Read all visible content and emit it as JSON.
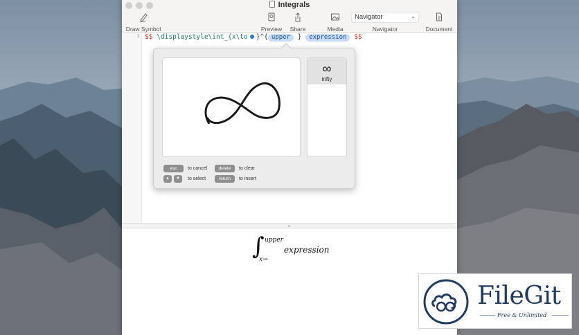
{
  "window": {
    "title": "Integrals"
  },
  "toolbar": {
    "draw_symbol_label": "Draw Symbol",
    "preview_label": "Preview",
    "share_label": "Share",
    "media_label": "Media",
    "navigator_label": "Navigator",
    "navigator_selected": "Navigator",
    "document_label": "Document"
  },
  "editor": {
    "line_number": "1",
    "code_prefix_dollar": "$$",
    "code_command": "\\displaystyle\\int_{x\\to",
    "code_after_dot": "}^{",
    "token_upper": "upper",
    "code_close_brace": "}",
    "token_expression": "expression",
    "code_suffix_dollar": "$$"
  },
  "draw_popover": {
    "result": {
      "glyph": "∞",
      "label": "infty"
    },
    "hints": {
      "esc_key": "esc",
      "cancel_text": "to cancel",
      "delete_key": "delete",
      "clear_text": "to clear",
      "up_key": "▲",
      "down_key": "▼",
      "select_text": "to select",
      "return_key": "return",
      "insert_text": "to insert"
    }
  },
  "preview": {
    "integral_symbol": "∫",
    "upper_limit": "upper",
    "lower_limit": "x→",
    "integrand": "expression"
  },
  "watermark": {
    "name": "FileGit",
    "tagline": "Free & Unlimited"
  },
  "colors": {
    "accent": "#2b78e4",
    "token_bg": "#c8ddf5",
    "watermark": "#213a63"
  }
}
